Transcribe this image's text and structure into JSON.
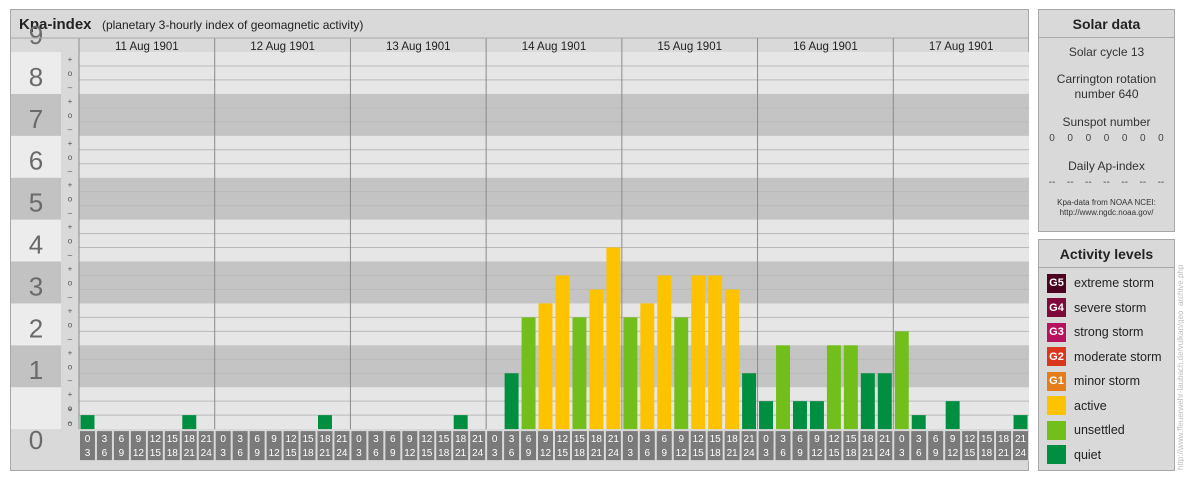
{
  "title": "Kpa-index",
  "subtitle": "(planetary 3-hourly index of geomagnetic activity)",
  "chart_data": {
    "type": "bar",
    "title": "Kpa-index",
    "subtitle": "(planetary 3-hourly index of geomagnetic activity)",
    "ylim": [
      0,
      9
    ],
    "y_ticks": [
      "0",
      "1",
      "2",
      "3",
      "4",
      "5",
      "6",
      "7",
      "8",
      "9"
    ],
    "thirds_labels": [
      "+",
      "o",
      "–"
    ],
    "hour_labels_top": [
      "0",
      "3",
      "6",
      "9",
      "12",
      "15",
      "18",
      "21"
    ],
    "hour_labels_bottom": [
      "3",
      "6",
      "9",
      "12",
      "15",
      "18",
      "21",
      "24"
    ],
    "days": [
      "11 Aug 1901",
      "12 Aug 1901",
      "13 Aug 1901",
      "14 Aug 1901",
      "15 Aug 1901",
      "16 Aug 1901",
      "17 Aug 1901"
    ],
    "values": [
      [
        0.333,
        0,
        0,
        0,
        0,
        0,
        0.333,
        0
      ],
      [
        0,
        0,
        0,
        0,
        0,
        0,
        0.333,
        0
      ],
      [
        0,
        0,
        0,
        0,
        0,
        0,
        0.333,
        0
      ],
      [
        0,
        1.333,
        2.667,
        3,
        3.667,
        2.667,
        3.333,
        4.333
      ],
      [
        2.667,
        3,
        3.667,
        2.667,
        3.667,
        3.667,
        3.333,
        1.333
      ],
      [
        0.667,
        2,
        0.667,
        0.667,
        2,
        2,
        1.333,
        1.333
      ],
      [
        2.333,
        0.333,
        0,
        0.667,
        0,
        0,
        0,
        0.333
      ]
    ],
    "grid": true
  },
  "colors": {
    "quiet": "#008e40",
    "unsettled": "#72bf1c",
    "active": "#fdc300",
    "G1": "#e57d1c",
    "G2": "#d9361d",
    "G3": "#b7125d",
    "G4": "#7d0a3b",
    "G5": "#4c0322"
  },
  "solar": {
    "heading": "Solar data",
    "cycle": "Solar cycle 13",
    "rotation_line1": "Carrington rotation",
    "rotation_line2": "number 640",
    "sunspot_label": "Sunspot number",
    "sunspot_values": [
      "0",
      "0",
      "0",
      "0",
      "0",
      "0",
      "0"
    ],
    "ap_label": "Daily Ap-index",
    "ap_values": [
      "--",
      "--",
      "--",
      "--",
      "--",
      "--",
      "--"
    ],
    "note_line1": "Kpa-data from NOAA NCEI:",
    "note_line2": "http://www.ngdc.noaa.gov/"
  },
  "activity": {
    "heading": "Activity levels",
    "items": [
      {
        "badge": "G5",
        "label": "extreme storm",
        "color": "#4c0322"
      },
      {
        "badge": "G4",
        "label": "severe storm",
        "color": "#7d0a3b"
      },
      {
        "badge": "G3",
        "label": "strong storm",
        "color": "#b7125d"
      },
      {
        "badge": "G2",
        "label": "moderate storm",
        "color": "#d9361d"
      },
      {
        "badge": "G1",
        "label": "minor storm",
        "color": "#e57d1c"
      },
      {
        "badge": "",
        "label": "active",
        "color": "#fdc300"
      },
      {
        "badge": "",
        "label": "unsettled",
        "color": "#72bf1c"
      },
      {
        "badge": "",
        "label": "quiet",
        "color": "#008e40"
      }
    ]
  },
  "watermark": "http://www.ffeuerwehr-laubach.de/vulkan/geo_archive.php"
}
